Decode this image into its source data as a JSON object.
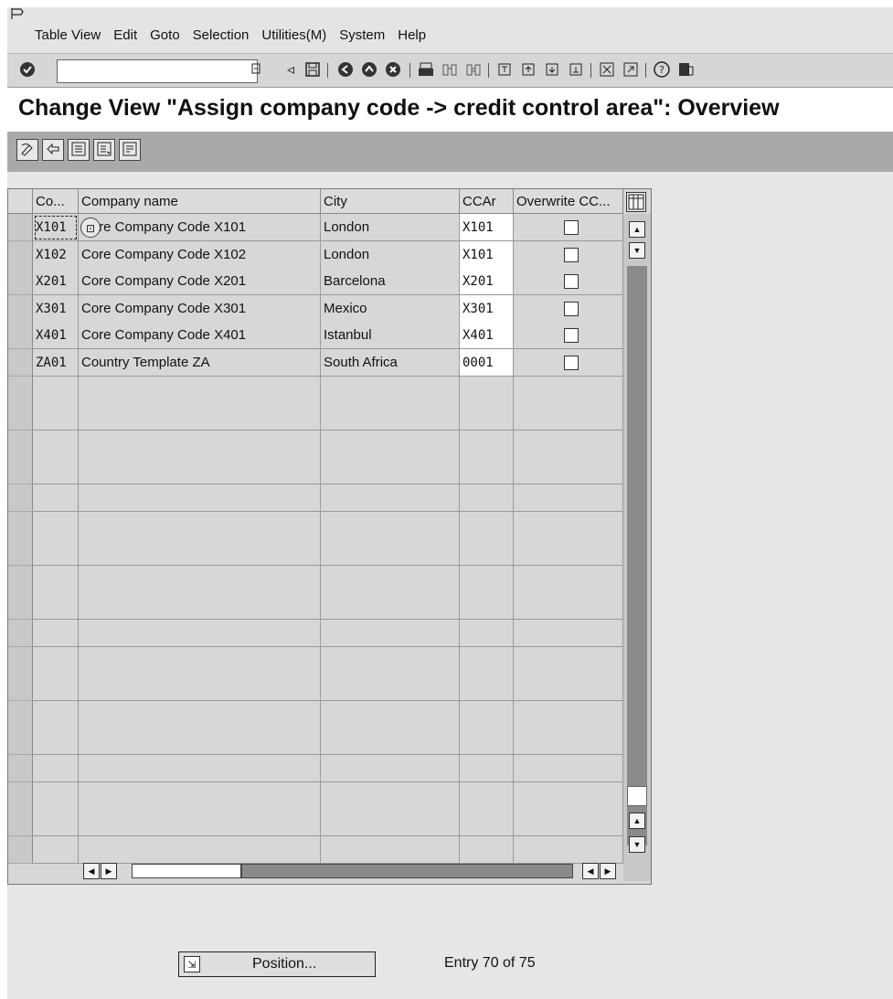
{
  "menu": {
    "corner_icon": "menu-corner-icon",
    "items": [
      {
        "label": "Table View"
      },
      {
        "label": "Edit"
      },
      {
        "label": "Goto"
      },
      {
        "label": "Selection"
      },
      {
        "label": "Utilities(M)"
      },
      {
        "label": "System"
      },
      {
        "label": "Help"
      }
    ]
  },
  "toolbar": {
    "command_value": "",
    "icons": [
      "enter-icon",
      "save-icon",
      "back-icon",
      "exit-icon",
      "cancel-icon",
      "print-icon",
      "find-icon",
      "find-next-icon",
      "first-page-icon",
      "previous-page-icon",
      "next-page-icon",
      "last-page-icon",
      "create-session-icon",
      "shortcut-icon",
      "help-icon",
      "customize-layout-icon"
    ]
  },
  "title": "Change View \"Assign company code -> credit control area\": Overview",
  "app_toolbar": {
    "icons": [
      "change-display-icon",
      "undo-icon",
      "select-all-icon",
      "select-block-icon",
      "deselect-all-icon"
    ]
  },
  "table": {
    "columns": [
      "Co...",
      "Company name",
      "City",
      "CCAr",
      "Overwrite CC..."
    ],
    "rows": [
      {
        "code": "X101",
        "name": "Core Company Code X101",
        "city": "London",
        "ccar": "X101",
        "overwrite": false
      },
      {
        "code": "X102",
        "name": "Core Company Code X102",
        "city": "London",
        "ccar": "X101",
        "overwrite": false
      },
      {
        "code": "X201",
        "name": "Core Company Code X201",
        "city": "Barcelona",
        "ccar": "X201",
        "overwrite": false
      },
      {
        "code": "X301",
        "name": "Core Company Code X301",
        "city": "Mexico",
        "ccar": "X301",
        "overwrite": false
      },
      {
        "code": "X401",
        "name": "Core Company Code X401",
        "city": "Istanbul",
        "ccar": "X401",
        "overwrite": false
      },
      {
        "code": "ZA01",
        "name": "Country Template ZA",
        "city": "South Africa",
        "ccar": "0001",
        "overwrite": false
      }
    ],
    "empty_rows": 18,
    "vertical_scroll_position": 0.93,
    "horizontal_scroll_position": 0.0
  },
  "footer": {
    "position_label": "Position...",
    "entry_text": "Entry 70 of 75"
  },
  "colors": {
    "title_bar": "#e4e4e4",
    "toolbar": "#d6d6d6",
    "app_toolbar": "#a9a9a9",
    "work_area": "#e6e6e6",
    "input_cell": "#ffffff"
  }
}
